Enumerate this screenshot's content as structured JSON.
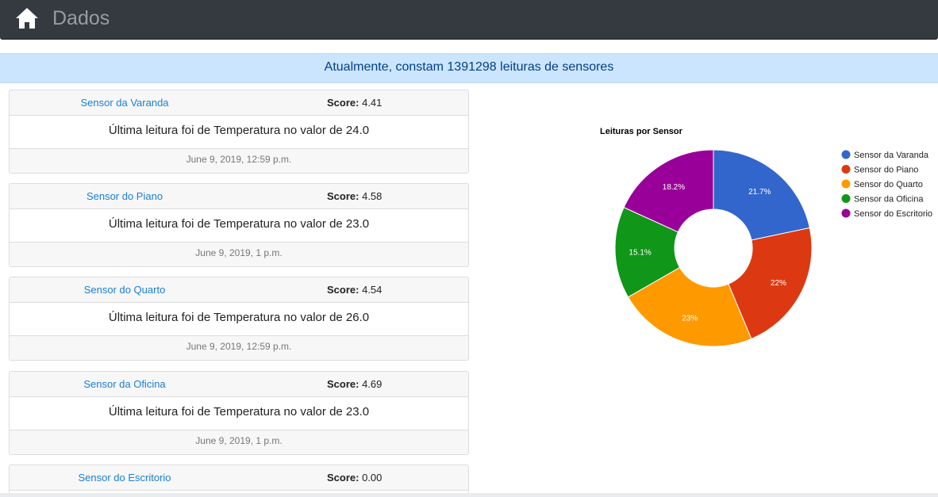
{
  "navbar": {
    "title": "Dados",
    "home_icon": "home-icon"
  },
  "alert": {
    "text": "Atualmente, constam 1391298 leituras de sensores"
  },
  "sensors": [
    {
      "name": "Sensor da Varanda",
      "score_label": "Score:",
      "score": "4.41",
      "reading": "Última leitura foi de Temperatura no valor de 24.0",
      "timestamp": "June 9, 2019, 12:59 p.m."
    },
    {
      "name": "Sensor do Piano",
      "score_label": "Score:",
      "score": "4.58",
      "reading": "Última leitura foi de Temperatura no valor de 23.0",
      "timestamp": "June 9, 2019, 1 p.m."
    },
    {
      "name": "Sensor do Quarto",
      "score_label": "Score:",
      "score": "4.54",
      "reading": "Última leitura foi de Temperatura no valor de 26.0",
      "timestamp": "June 9, 2019, 12:59 p.m."
    },
    {
      "name": "Sensor da Oficina",
      "score_label": "Score:",
      "score": "4.69",
      "reading": "Última leitura foi de Temperatura no valor de 23.0",
      "timestamp": "June 9, 2019, 1 p.m."
    },
    {
      "name": "Sensor do Escritorio",
      "score_label": "Score:",
      "score": "0.00",
      "reading": "",
      "timestamp": ""
    }
  ],
  "chart_data": {
    "type": "pie",
    "title": "Leituras por Sensor",
    "categories": [
      "Sensor da Varanda",
      "Sensor do Piano",
      "Sensor do Quarto",
      "Sensor da Oficina",
      "Sensor do Escritorio"
    ],
    "values": [
      21.7,
      22,
      23,
      15.1,
      18.2
    ],
    "labels": [
      "21.7%",
      "22%",
      "23%",
      "15.1%",
      "18.2%"
    ],
    "colors": [
      "#3366cc",
      "#dc3912",
      "#ff9900",
      "#109618",
      "#990099"
    ],
    "legend": "right",
    "donut": true
  }
}
